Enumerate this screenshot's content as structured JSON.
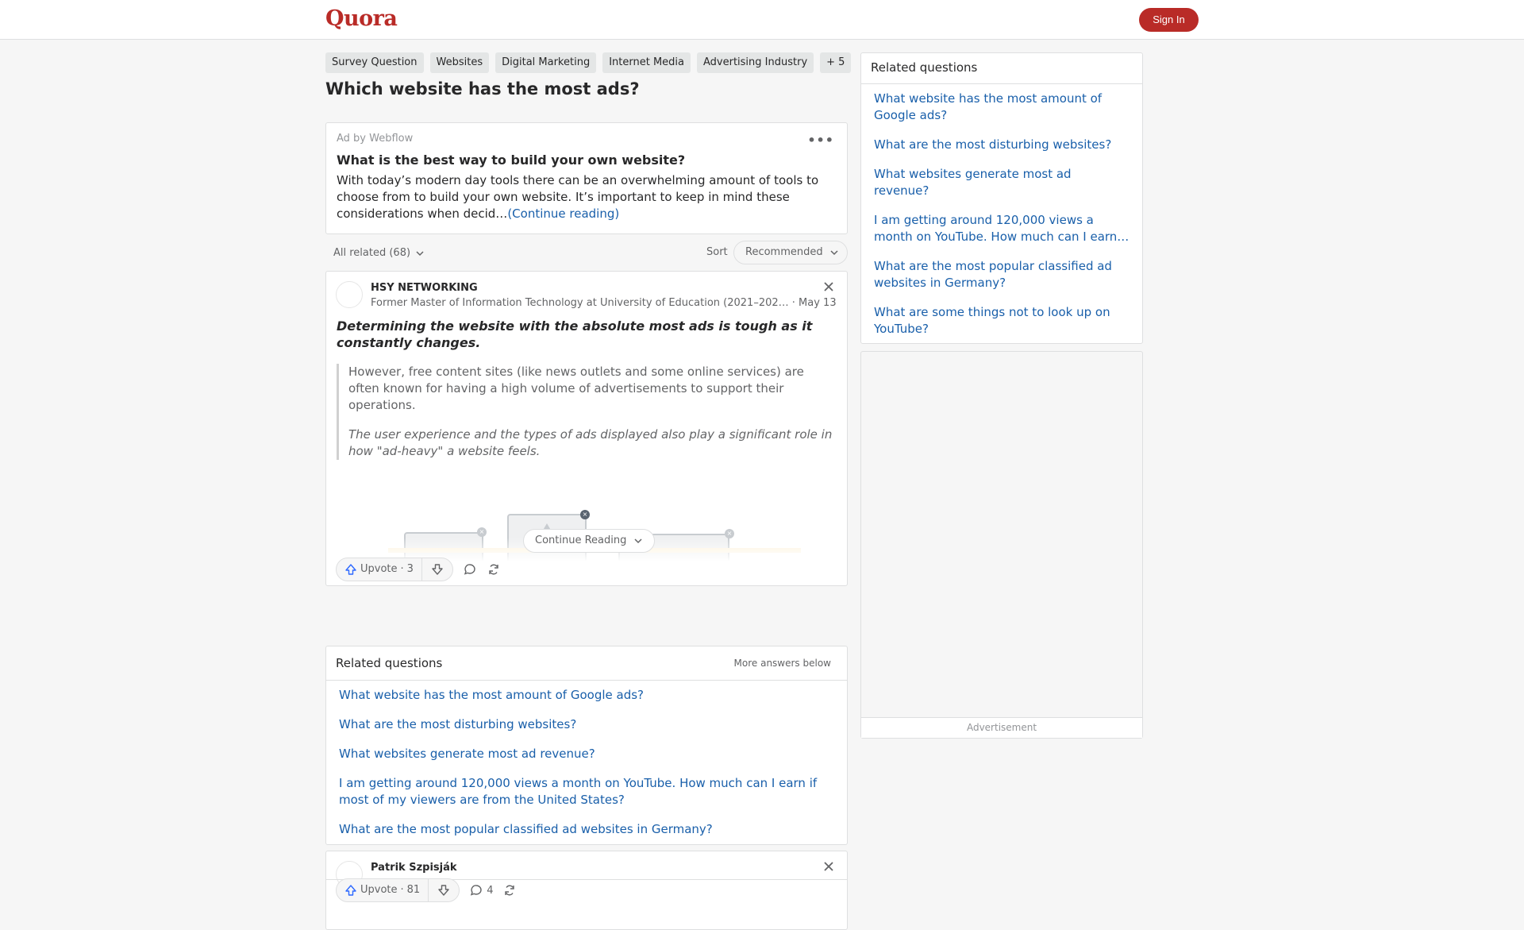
{
  "header": {
    "logo": "Quora",
    "sign_in": "Sign In"
  },
  "topics": [
    "Survey Question",
    "Websites",
    "Digital Marketing",
    "Internet Media",
    "Advertising Industry",
    "+ 5"
  ],
  "question": {
    "title": "Which website has the most ads?"
  },
  "ad": {
    "by": "Ad by Webflow",
    "more": "•••",
    "title": "What is the best way to build your own website?",
    "body": "With today’s modern day tools there can be an overwhelming amount of tools to choose from to build your own website. It’s important to keep in mind these considerations when decid…",
    "continue": "(Continue reading)"
  },
  "sortbar": {
    "all_related": "All related (68)",
    "sort_label": "Sort",
    "sort_value": "Recommended"
  },
  "answer1": {
    "author": "HSY NETWORKING",
    "credential": "Former Master of Information Technology at University of Education (2021–202…",
    "date": " · May 13",
    "lead": "Determining the website with the absolute most ads is tough as it constantly changes.",
    "quote1": "However, free content sites (like news outlets and some online services) are often known for having a high volume of advertisements to support their operations.",
    "quote2": "The user experience and the types of ads displayed also play a significant role in how \"ad-heavy\" a website feels.",
    "continue_reading": "Continue Reading",
    "upvote_label": "Upvote",
    "upvote_count": "3"
  },
  "related_inline": {
    "title": "Related questions",
    "more_below": "More answers below",
    "items": [
      "What website has the most amount of Google ads?",
      "What are the most disturbing websites?",
      "What websites generate most ad revenue?",
      "I am getting around 120,000 views a month on YouTube. How much can I earn if most of my viewers are from the United States?",
      "What are the most popular classified ad websites in Germany?"
    ]
  },
  "answer2": {
    "author": "Patrik Szpisják",
    "upvote_label": "Upvote",
    "upvote_count": "81",
    "comments": "4"
  },
  "sidebar": {
    "title": "Related questions",
    "items": [
      "What website has the most amount of Google ads?",
      "What are the most disturbing websites?",
      "What websites generate most ad revenue?",
      "I am getting around 120,000 views a month on YouTube. How much can I earn…",
      "What are the most popular classified ad websites in Germany?",
      "What are some things not to look up on YouTube?"
    ],
    "ad_label": "Advertisement"
  }
}
